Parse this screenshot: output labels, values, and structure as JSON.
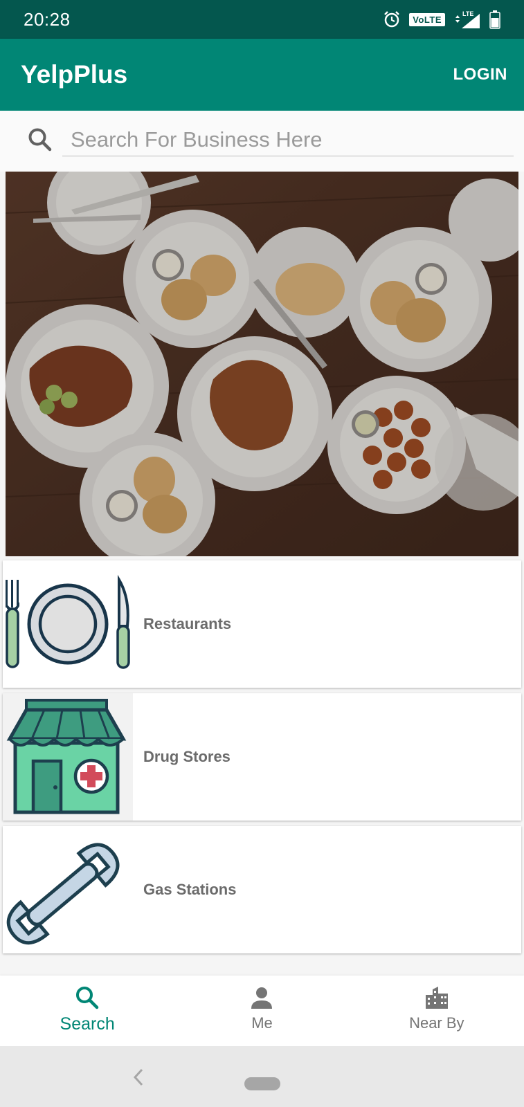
{
  "status_bar": {
    "time": "20:28",
    "network_label": "VoLTE",
    "lte_label": "LTE",
    "icons": [
      "alarm-icon",
      "volte-icon",
      "signal-icon",
      "battery-icon"
    ]
  },
  "app_bar": {
    "title": "YelpPlus",
    "login_label": "LOGIN"
  },
  "search": {
    "placeholder": "Search For Business Here",
    "value": ""
  },
  "hero": {
    "icon": "food-table-photo"
  },
  "categories": [
    {
      "label": "Restaurants",
      "icon": "restaurant-icon"
    },
    {
      "label": "Drug Stores",
      "icon": "drug-store-icon"
    },
    {
      "label": "Gas Stations",
      "icon": "wrench-icon"
    }
  ],
  "bottom_nav": {
    "items": [
      {
        "label": "Search",
        "icon": "search-icon",
        "active": true
      },
      {
        "label": "Me",
        "icon": "person-icon",
        "active": false
      },
      {
        "label": "Near By",
        "icon": "city-icon",
        "active": false
      }
    ]
  },
  "colors": {
    "status_bar": "#04574e",
    "primary": "#018675",
    "card_text": "#6b6b6b",
    "inactive_nav": "#757575"
  }
}
